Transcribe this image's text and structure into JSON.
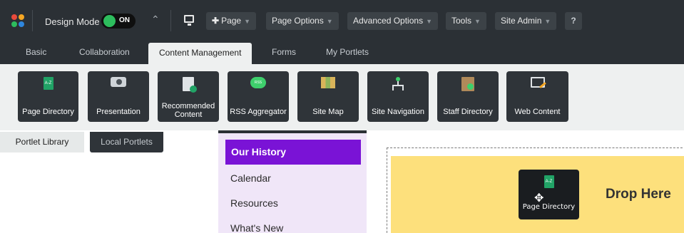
{
  "toolbar": {
    "mode_label": "Design Mode",
    "toggle_state": "ON",
    "toggle_color": "#2dbd5d",
    "collapse_icon": "double-chevron-up-icon",
    "screen_icon": "monitor-icon",
    "add_page": "Page",
    "page_options": "Page Options",
    "advanced_options": "Advanced Options",
    "tools": "Tools",
    "site_admin": "Site Admin",
    "help": "?"
  },
  "tabs": [
    {
      "label": "Basic",
      "active": false
    },
    {
      "label": "Collaboration",
      "active": false
    },
    {
      "label": "Content Management",
      "active": true
    },
    {
      "label": "Forms",
      "active": false
    },
    {
      "label": "My Portlets",
      "active": false
    }
  ],
  "portlets": [
    {
      "label": "Page Directory",
      "icon": "page-directory-icon"
    },
    {
      "label": "Presentation",
      "icon": "projector-icon"
    },
    {
      "label": "Recommended Content",
      "icon": "recommended-doc-icon"
    },
    {
      "label": "RSS Aggregator",
      "icon": "rss-bubble-icon"
    },
    {
      "label": "Site Map",
      "icon": "map-icon"
    },
    {
      "label": "Site Navigation",
      "icon": "sitemap-tree-icon"
    },
    {
      "label": "Staff Directory",
      "icon": "staff-book-icon"
    },
    {
      "label": "Web Content",
      "icon": "monitor-edit-icon"
    }
  ],
  "library_tabs": {
    "portlet_library": "Portlet Library",
    "local_portlets": "Local Portlets"
  },
  "nav": [
    {
      "label": "Our History",
      "active": true
    },
    {
      "label": "Calendar",
      "active": false
    },
    {
      "label": "Resources",
      "active": false
    },
    {
      "label": "What's New",
      "active": false
    }
  ],
  "dropzone": {
    "label": "Drop Here",
    "dragging_label": "Page Directory"
  },
  "colors": {
    "toolbar_bg": "#2b3035",
    "nav_active": "#7a13d6",
    "nav_bg": "#f0e6f8",
    "drop_bg": "#fde07c"
  }
}
